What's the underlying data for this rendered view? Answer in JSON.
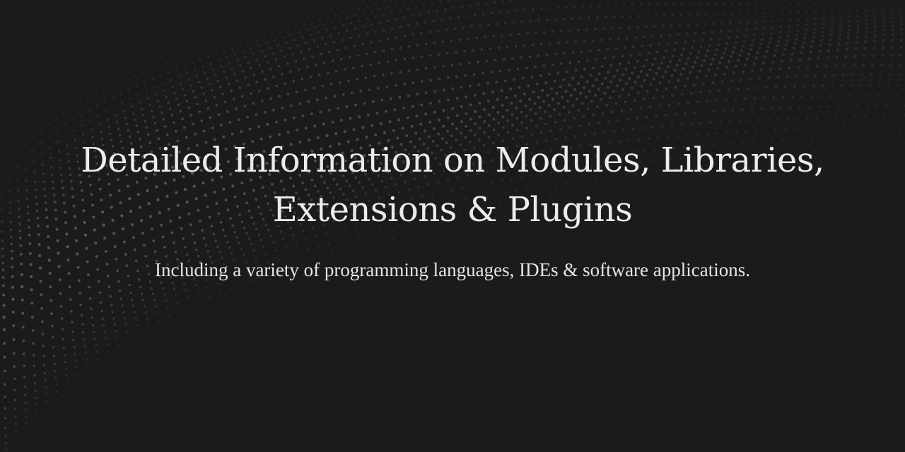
{
  "hero": {
    "background_color": "#1b1b1c",
    "dot_color": "#8a8a8a",
    "title_line_1": "Detailed Information on Modules, Libraries,",
    "title_line_2": "Extensions & Plugins",
    "subtitle": "Including a variety of programming languages, IDEs & software applications."
  }
}
